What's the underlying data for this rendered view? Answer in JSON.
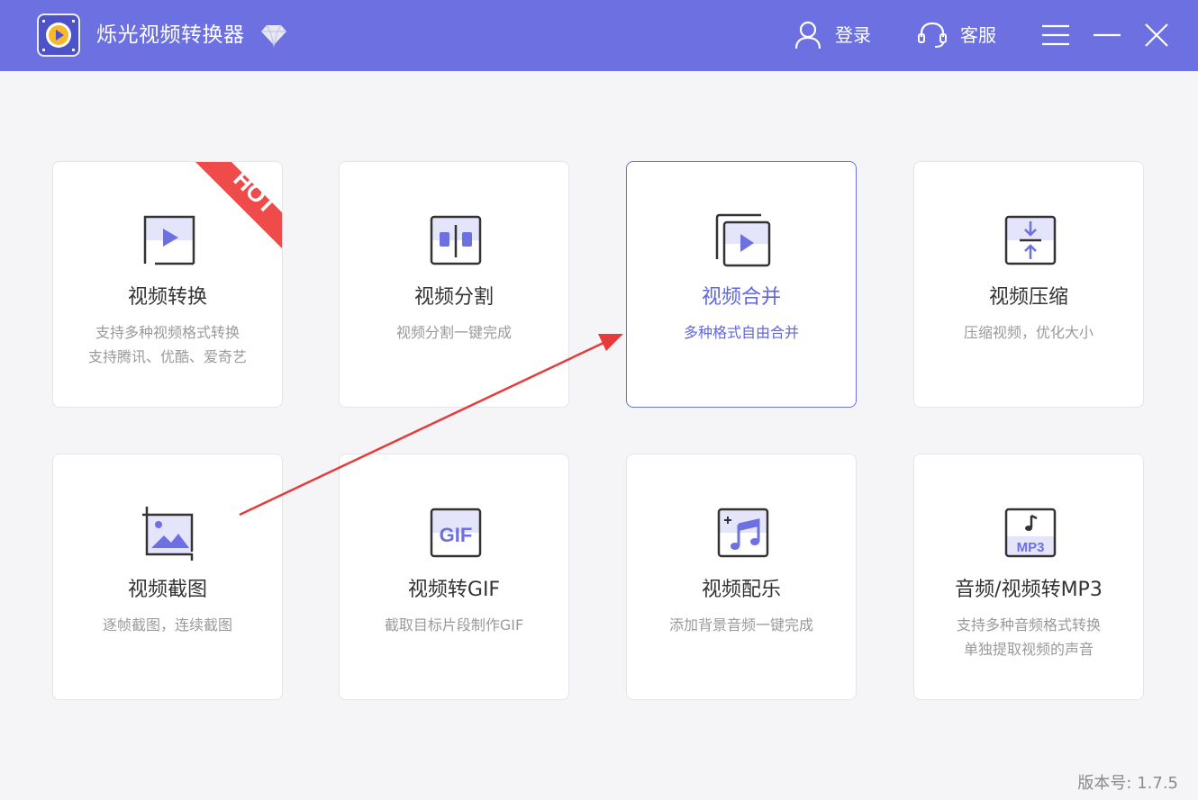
{
  "app": {
    "title": "烁光视频转换器",
    "logo_icon": "video-disc-icon",
    "vip_icon": "diamond-icon",
    "brand_color": "#6c70e0"
  },
  "titlebar": {
    "login_label": "登录",
    "service_label": "客服",
    "menu_icon": "hamburger-menu-icon",
    "minimize_icon": "minimize-icon",
    "close_icon": "close-icon"
  },
  "cards": [
    {
      "title": "视频转换",
      "desc": [
        "支持多种视频格式转换",
        "支持腾讯、优酷、爱奇艺"
      ],
      "icon": "video-play-icon",
      "badge": "HOT"
    },
    {
      "title": "视频分割",
      "desc": [
        "视频分割一键完成"
      ],
      "icon": "split-icon"
    },
    {
      "title": "视频合并",
      "desc": [
        "多种格式自由合并"
      ],
      "icon": "merge-icon",
      "active": true
    },
    {
      "title": "视频压缩",
      "desc": [
        "压缩视频，优化大小"
      ],
      "icon": "compress-icon"
    },
    {
      "title": "视频截图",
      "desc": [
        "逐帧截图，连续截图"
      ],
      "icon": "crop-image-icon"
    },
    {
      "title": "视频转GIF",
      "desc": [
        "截取目标片段制作GIF"
      ],
      "icon": "gif-icon",
      "icon_text": "GIF"
    },
    {
      "title": "视频配乐",
      "desc": [
        "添加背景音频一键完成"
      ],
      "icon": "music-note-icon"
    },
    {
      "title": "音频/视频转MP3",
      "desc": [
        "支持多种音频格式转换",
        "单独提取视频的声音"
      ],
      "icon": "mp3-icon",
      "icon_text": "MP3"
    }
  ],
  "annotation": {
    "type": "red-arrow",
    "color": "#e63b3b"
  },
  "footer": {
    "version": "版本号: 1.7.5"
  }
}
